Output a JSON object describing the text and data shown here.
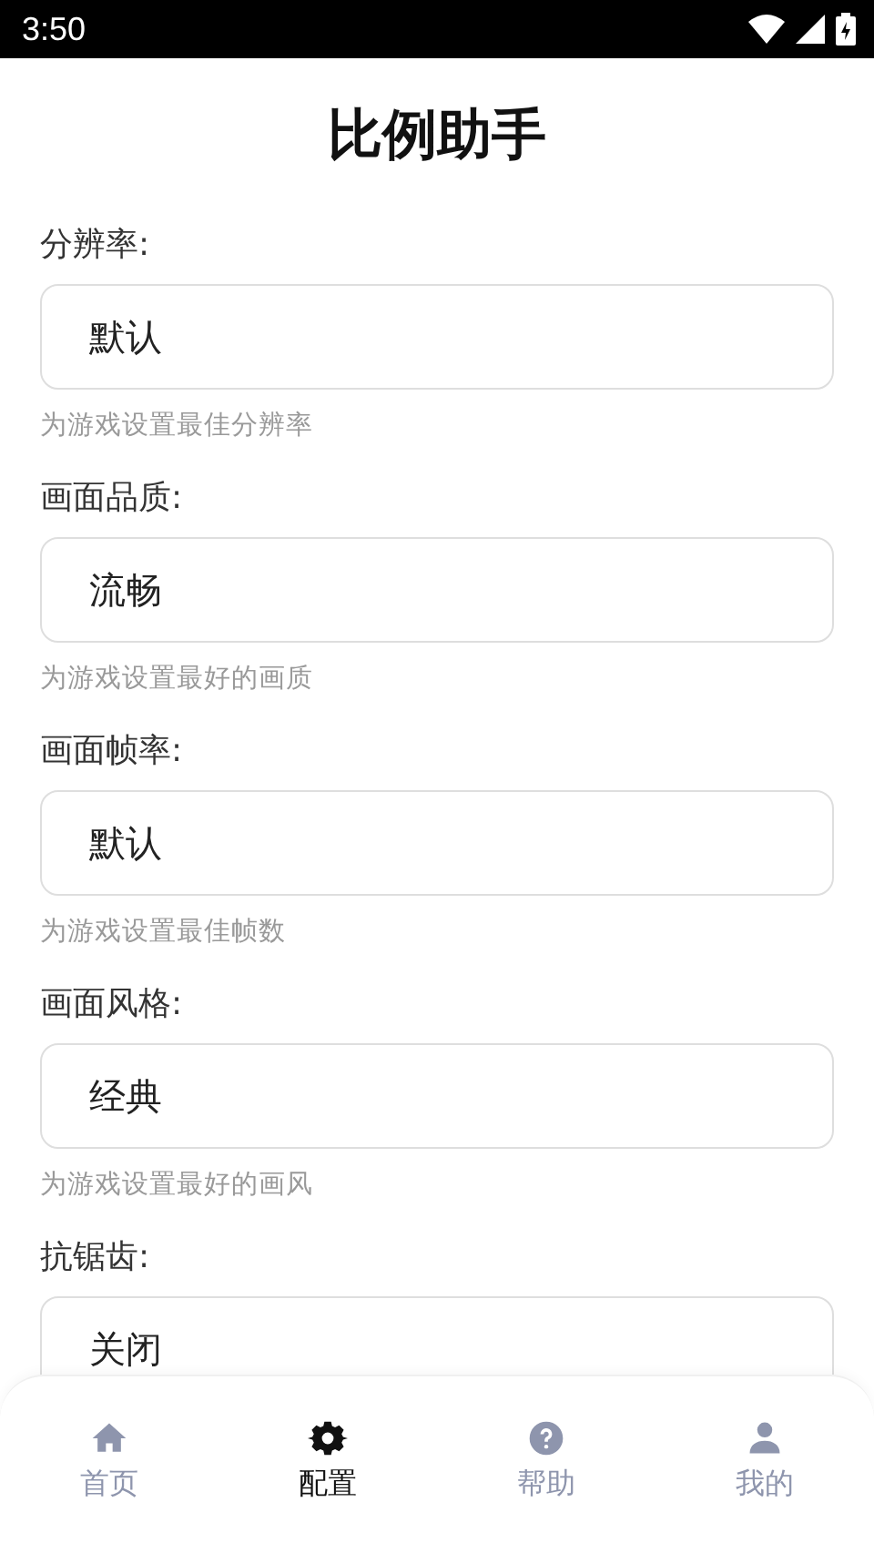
{
  "status_bar": {
    "time": "3:50"
  },
  "title": "比例助手",
  "settings": [
    {
      "label": "分辨率:",
      "value": "默认",
      "hint": "为游戏设置最佳分辨率"
    },
    {
      "label": "画面品质:",
      "value": "流畅",
      "hint": "为游戏设置最好的画质"
    },
    {
      "label": "画面帧率:",
      "value": "默认",
      "hint": "为游戏设置最佳帧数"
    },
    {
      "label": "画面风格:",
      "value": "经典",
      "hint": "为游戏设置最好的画风"
    },
    {
      "label": "抗锯齿:",
      "value": "关闭"
    }
  ],
  "nav": [
    {
      "label": "首页",
      "selected": false
    },
    {
      "label": "配置",
      "selected": true
    },
    {
      "label": "帮助",
      "selected": false
    },
    {
      "label": "我的",
      "selected": false
    }
  ]
}
